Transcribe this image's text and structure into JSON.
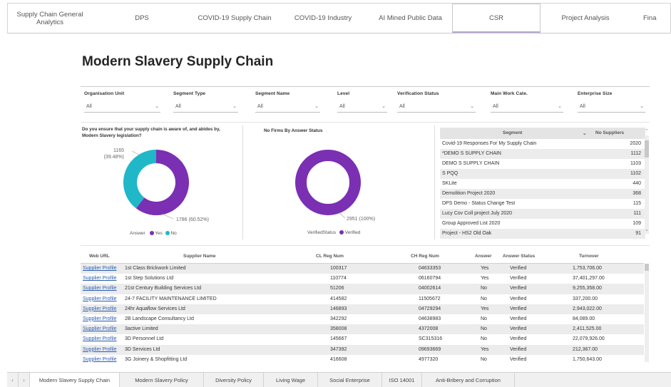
{
  "top_tabs": [
    {
      "label": "Supply Chain General Analytics",
      "active": false
    },
    {
      "label": "DPS",
      "active": false
    },
    {
      "label": "COVID-19 Supply Chain",
      "active": false
    },
    {
      "label": "COVID-19 Industry",
      "active": false
    },
    {
      "label": "AI Mined Public Data",
      "active": false
    },
    {
      "label": "CSR",
      "active": true
    },
    {
      "label": "Project Analysis",
      "active": false
    },
    {
      "label": "Fina",
      "active": false
    }
  ],
  "page_title": "Modern Slavery Supply Chain",
  "filters": [
    {
      "label": "Organisation Unit",
      "value": "All"
    },
    {
      "label": "Segment Type",
      "value": "All"
    },
    {
      "label": "Segment Name",
      "value": "All"
    },
    {
      "label": "Level",
      "value": "All"
    },
    {
      "label": "Verification Status",
      "value": "All"
    },
    {
      "label": "Main Work Cate.",
      "value": "All"
    },
    {
      "label": "Enterprise Size",
      "value": "All"
    }
  ],
  "chart_data": [
    {
      "type": "pie",
      "donut": true,
      "title": "Do you ensure that your supply chain is aware of, and abides by, Modern Slavery legislation?",
      "legend_title": "Answer",
      "legend_position": "bottom",
      "categories": [
        "Yes",
        "No"
      ],
      "values": [
        1786,
        1165
      ],
      "labels": [
        "1786 (60.52%)",
        "1165 (39.48%)"
      ],
      "label_lines": [
        [
          "1165",
          "(39.48%)"
        ],
        [
          "1786 (60.52%)"
        ]
      ],
      "colors": [
        "#7b2fb3",
        "#20b7c9"
      ]
    },
    {
      "type": "pie",
      "donut": true,
      "title": "No Firms By Answer Status",
      "legend_title": "VerifiedStatus",
      "legend_position": "bottom",
      "categories": [
        "Verified"
      ],
      "values": [
        2951
      ],
      "labels": [
        "2951 (100%)"
      ],
      "colors": [
        "#7b2fb3"
      ]
    }
  ],
  "segment_table": {
    "headers": [
      "Segment",
      "No Suppliers"
    ],
    "rows": [
      {
        "segment": "Covid-19 Responses For My Supply Chain",
        "count": "2020"
      },
      {
        "segment": "*DEMO S SUPPLY CHAIN",
        "count": "1112"
      },
      {
        "segment": "DEMO S SUPPLY CHAIN",
        "count": "1103"
      },
      {
        "segment": "S PQQ",
        "count": "1102"
      },
      {
        "segment": "SKLite",
        "count": "440"
      },
      {
        "segment": "Demolition Project 2020",
        "count": "368"
      },
      {
        "segment": "DPS Demo - Status Change Test",
        "count": "115"
      },
      {
        "segment": "Lucy Cov Coll project July 2020",
        "count": "111"
      },
      {
        "segment": "Group Approved List 2020",
        "count": "109"
      },
      {
        "segment": "Project - HS2 Old Oak",
        "count": "91"
      }
    ]
  },
  "supplier_table": {
    "headers": [
      "Web URL",
      "Supplier Name",
      "CL Reg Num",
      "CH Reg Num",
      "Answer",
      "Answer Status",
      "Turnover"
    ],
    "rows": [
      {
        "url": "Supplier Profile",
        "name": "1st Class Brickwork Limited",
        "cl": "100317",
        "ch": "04633353",
        "answer": "Yes",
        "status": "Verified",
        "turnover": "1,753,706.00"
      },
      {
        "url": "Supplier Profile",
        "name": "1st Step Solutions Ltd",
        "cl": "110774",
        "ch": "06160794",
        "answer": "Yes",
        "status": "Verified",
        "turnover": "37,401,297.00"
      },
      {
        "url": "Supplier Profile",
        "name": "21st Century Building Services Ltd",
        "cl": "51206",
        "ch": "04002614",
        "answer": "No",
        "status": "Verified",
        "turnover": "9,255,358.00"
      },
      {
        "url": "Supplier Profile",
        "name": "24-7 FACILITY MAINTENANCE LIMITED",
        "cl": "414582",
        "ch": "11505672",
        "answer": "No",
        "status": "Verified",
        "turnover": "337,200.00"
      },
      {
        "url": "Supplier Profile",
        "name": "24hr Aquaflow Services Ltd",
        "cl": "146893",
        "ch": "04729294",
        "answer": "Yes",
        "status": "Verified",
        "turnover": "2,943,022.00"
      },
      {
        "url": "Supplier Profile",
        "name": "2B Landscape Consultancy Ltd",
        "cl": "342292",
        "ch": "04638983",
        "answer": "No",
        "status": "Verified",
        "turnover": "84,089.00"
      },
      {
        "url": "Supplier Profile",
        "name": "3active Limited",
        "cl": "358008",
        "ch": "4372008",
        "answer": "No",
        "status": "Verified",
        "turnover": "2,411,525.00"
      },
      {
        "url": "Supplier Profile",
        "name": "3D Personnel Ltd",
        "cl": "145667",
        "ch": "SC315316",
        "answer": "No",
        "status": "Verified",
        "turnover": "22,079,926.00"
      },
      {
        "url": "Supplier Profile",
        "name": "3D Services Ltd",
        "cl": "347392",
        "ch": "09693669",
        "answer": "Yes",
        "status": "Verified",
        "turnover": "212,367.00"
      },
      {
        "url": "Supplier Profile",
        "name": "3G Joinery & Shopfitting Ltd",
        "cl": "416608",
        "ch": "4977320",
        "answer": "No",
        "status": "Verified",
        "turnover": "1,750,643.00"
      }
    ]
  },
  "bottom_tabs": [
    {
      "label": "Modern Slavery Supply Chain",
      "active": true
    },
    {
      "label": "Modern Slavery Policy",
      "active": false
    },
    {
      "label": "Diversity Policy",
      "active": false
    },
    {
      "label": "Living Wage",
      "active": false
    },
    {
      "label": "Social Enterprise",
      "active": false
    },
    {
      "label": "ISO 14001",
      "active": false
    },
    {
      "label": "Anti-Bribery and Corruption",
      "active": false
    }
  ]
}
